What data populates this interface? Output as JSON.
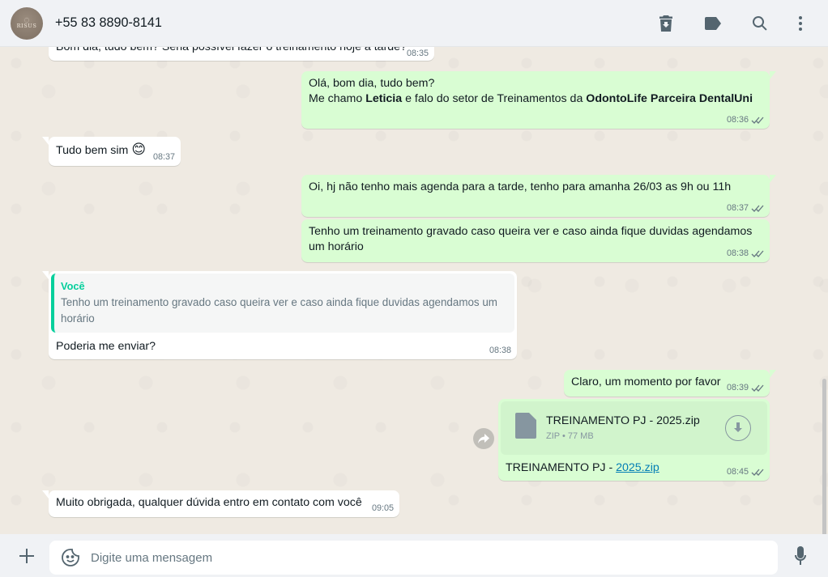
{
  "header": {
    "contact_name": "+55 83 8890-8141",
    "avatar_text": "RISUS",
    "icons": [
      "delete-icon",
      "label-icon",
      "search-icon",
      "menu-icon"
    ]
  },
  "messages": [
    {
      "dir": "in",
      "text": "Bom dia, tudo bem? Seria possível fazer o treinamento hoje à tarde?",
      "time": "08:35"
    },
    {
      "dir": "out",
      "line1": "Olá, bom dia, tudo bem?",
      "line2_a": "Me chamo ",
      "line2_b": "Leticia",
      "line2_c": " e falo do setor de Treinamentos da ",
      "line2_d": "OdontoLife Parceira DentalUni",
      "time": "08:36"
    },
    {
      "dir": "in",
      "text": "Tudo bem sim",
      "emoji": "😊",
      "time": "08:37"
    },
    {
      "dir": "out",
      "text": "Oi, hj não tenho mais agenda para a tarde, tenho para amanha 26/03 as 9h ou 11h",
      "time": "08:37"
    },
    {
      "dir": "out",
      "text": "Tenho um treinamento gravado caso queira ver e caso ainda fique duvidas agendamos um horário",
      "time": "08:38"
    },
    {
      "dir": "in",
      "quote_author": "Você",
      "quote_text": "Tenho um treinamento gravado caso queira ver e caso ainda fique duvidas agendamos um horário",
      "text": "Poderia me enviar?",
      "time": "08:38"
    },
    {
      "dir": "out",
      "text": "Claro, um momento por favor",
      "time": "08:39"
    },
    {
      "dir": "out",
      "file_name": "TREINAMENTO PJ - 2025.zip",
      "file_meta": "ZIP • 77 MB",
      "caption_a": "TREINAMENTO PJ - ",
      "caption_link": "2025.zip",
      "time": "08:45"
    },
    {
      "dir": "in",
      "text": "Muito obrigada, qualquer dúvida entro em contato com você",
      "time": "09:05"
    }
  ],
  "composer": {
    "placeholder": "Digite uma mensagem"
  },
  "colors": {
    "outgoing_bubble": "#d9fdd3",
    "incoming_bubble": "#ffffff",
    "quote_accent": "#06cf9c",
    "read_ticks": "#667781"
  }
}
